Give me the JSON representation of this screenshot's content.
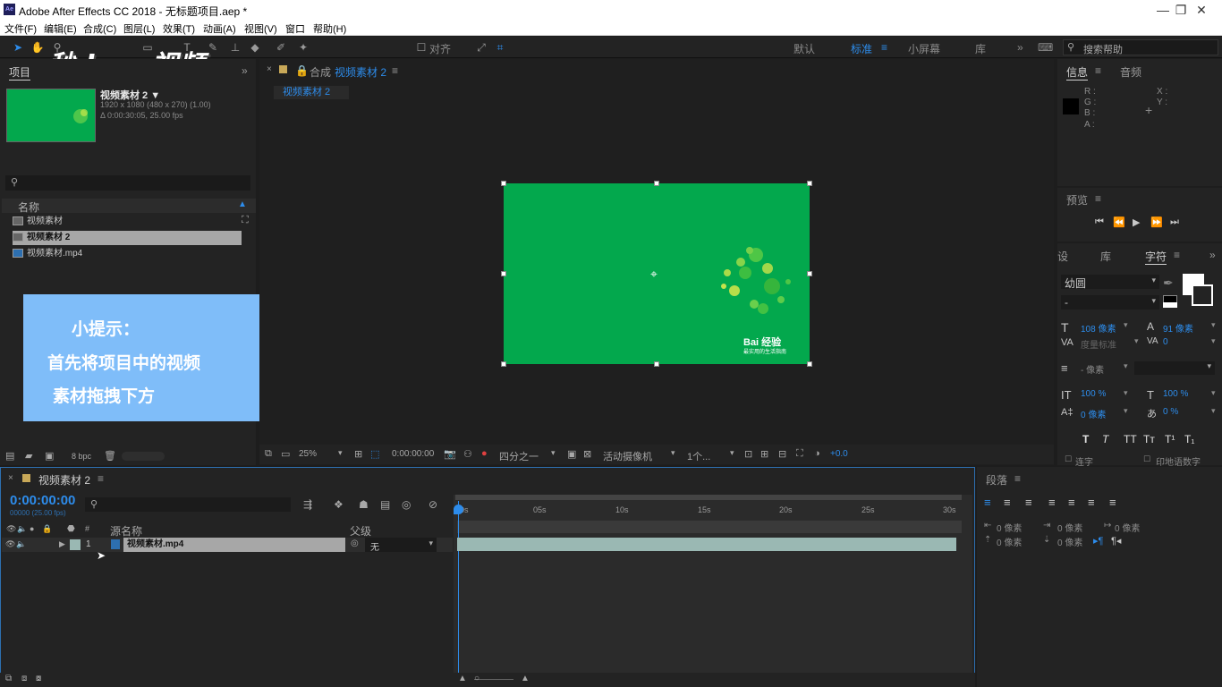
{
  "app": {
    "title": "Adobe After Effects CC 2018 - 无标题项目.aep *",
    "logo": "Ae",
    "window_controls": [
      "—",
      "❐",
      "✕"
    ]
  },
  "menu": [
    "文件(F)",
    "编辑(E)",
    "合成(C)",
    "图层(L)",
    "效果(T)",
    "动画(A)",
    "视图(V)",
    "窗口",
    "帮助(H)"
  ],
  "toolbar": {
    "snap_label": "对齐",
    "workspaces": [
      "默认",
      "标准",
      "小屏幕",
      "库"
    ],
    "active_workspace": "标准",
    "search_placeholder": "搜索帮助"
  },
  "watermark": "秒dong视频",
  "project": {
    "tab": "项目",
    "item_name": "视频素材 2 ▼",
    "item_info_1": "1920 x 1080 (480 x 270) (1.00)",
    "item_info_2": "Δ 0:00:30:05, 25.00 fps",
    "column_name": "名称",
    "items": [
      "视频素材",
      "视频素材 2",
      "视频素材.mp4"
    ],
    "bpc": "8 bpc"
  },
  "tip": {
    "title": "小提示：",
    "line1": "首先将项目中的视频",
    "line2": "素材拖拽下方"
  },
  "composition": {
    "tab_prefix": "合成",
    "tab_name": "视频素材 2",
    "subtab": "视频素材 2",
    "canvas_brand": "Bai 经验",
    "canvas_slogan": "最实用的生活指南",
    "footer": {
      "zoom": "25%",
      "timecode": "0:00:00:00",
      "resolution": "四分之一",
      "camera": "活动摄像机",
      "views": "1个...",
      "exposure": "+0.0"
    }
  },
  "info": {
    "tabs": [
      "信息",
      "音频"
    ],
    "rgba": [
      "R :",
      "G :",
      "B :",
      "A :"
    ],
    "xy": [
      "X :",
      "Y :"
    ]
  },
  "preview": {
    "tab": "预览"
  },
  "character": {
    "tabs": [
      "设",
      "库",
      "字符"
    ],
    "font": "幼圆",
    "style": "-",
    "size": "108 像素",
    "leading": "91 像素",
    "kerning": "度量标准",
    "tracking": "0",
    "stroke": "- 像素",
    "vscale": "100 %",
    "hscale": "100 %",
    "baseline": "0 像素",
    "tsume": "0 %",
    "ligatures": "连字",
    "hindi": "印地语数字"
  },
  "timeline": {
    "tab": "视频素材 2",
    "timecode": "0:00:00:00",
    "frames": "00000 (25.00 fps)",
    "col_source": "源名称",
    "col_parent": "父级",
    "layer_num": "1",
    "layer_name": "视频素材.mp4",
    "parent_value": "无",
    "ruler": [
      "0s",
      "05s",
      "10s",
      "15s",
      "20s",
      "25s",
      "30s"
    ]
  },
  "paragraph": {
    "tab": "段落",
    "values": [
      "0 像素",
      "0 像素",
      "0 像素",
      "0 像素",
      "0 像素"
    ]
  }
}
